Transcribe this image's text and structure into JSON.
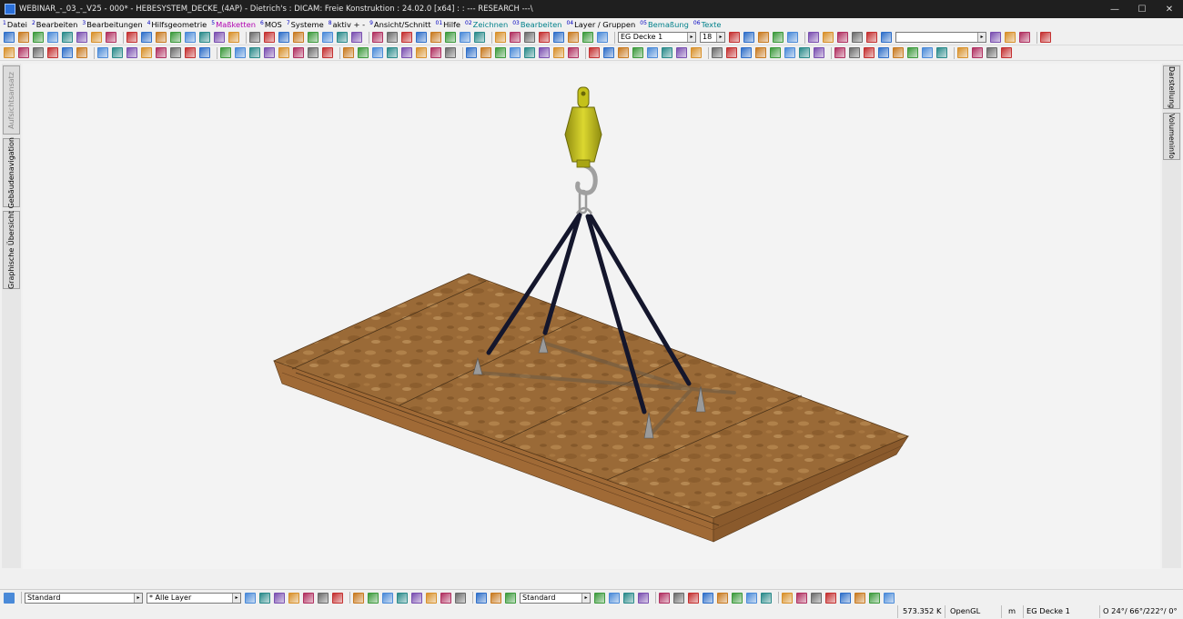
{
  "window": {
    "title": "WEBINAR_-_03_-_V25 - 000* - HEBESYSTEM_DECKE_(4AP) - Dietrich's : DICAM: Freie Konstruktion : 24.02.0 [x64] : : --- RESEARCH ---\\",
    "minimize": "—",
    "maximize": "☐",
    "close": "✕"
  },
  "menu": [
    {
      "num": "1",
      "label": "Datei",
      "color": ""
    },
    {
      "num": "2",
      "label": "Bearbeiten",
      "color": ""
    },
    {
      "num": "3",
      "label": "Bearbeitungen",
      "color": ""
    },
    {
      "num": "4",
      "label": "Hilfsgeometrie",
      "color": ""
    },
    {
      "num": "5",
      "label": "Maßketten",
      "color": "purple"
    },
    {
      "num": "6",
      "label": "MOS",
      "color": ""
    },
    {
      "num": "7",
      "label": "Systeme",
      "color": ""
    },
    {
      "num": "8",
      "label": "aktiv + -",
      "color": ""
    },
    {
      "num": "9",
      "label": "Ansicht/Schnitt",
      "color": ""
    },
    {
      "num": "01",
      "label": "Hilfe",
      "color": ""
    },
    {
      "num": "02",
      "label": "Zeichnen",
      "color": "teal"
    },
    {
      "num": "03",
      "label": "Bearbeiten",
      "color": "teal"
    },
    {
      "num": "04",
      "label": "Layer / Gruppen",
      "color": ""
    },
    {
      "num": "05",
      "label": "Bemaßung",
      "color": "teal"
    },
    {
      "num": "06",
      "label": "Texte",
      "color": "teal"
    }
  ],
  "toolbar": {
    "floor_select": "EG Decke 1",
    "size_select": "18",
    "empty_select": ""
  },
  "left_tabs": [
    "Aufsichtsansatz",
    "Gebäudenavigation",
    "Graphische Übersicht"
  ],
  "right_tabs": [
    "Darstellung",
    "Volumeninfo"
  ],
  "statusbar": {
    "style_select": "Standard",
    "layer_select": "* Alle Layer",
    "style_select2": "Standard"
  },
  "coords": {
    "value": "573.352 K",
    "renderer": "OpenGL",
    "unit": "m",
    "floor": "EG Decke 1",
    "angles": "O 24°/ 66°/222°/ 0°"
  },
  "colors": {
    "osb": "#a8743c",
    "timber_frame": "#a06a36",
    "sling": "#14162c",
    "hook_block": "#c4c11a"
  }
}
